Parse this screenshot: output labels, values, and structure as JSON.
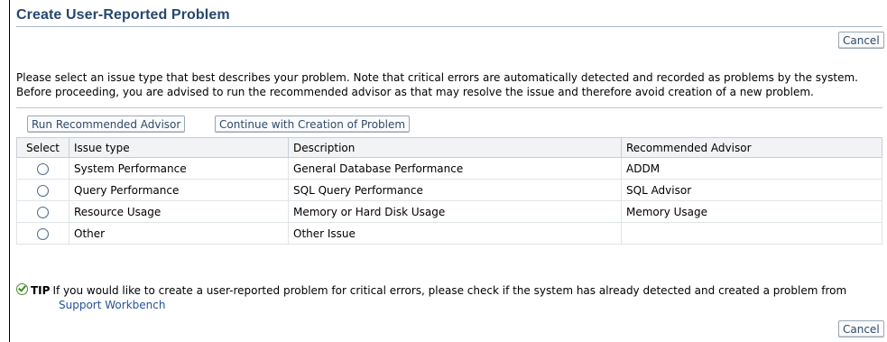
{
  "header": {
    "title": "Create User-Reported Problem",
    "cancel_label": "Cancel"
  },
  "intro": {
    "line1": "Please select an issue type that best describes your problem. Note that critical errors are automatically detected and recorded as problems by the system.",
    "line2": "Before proceeding, you are advised to run the recommended advisor as that may resolve the issue and therefore avoid creation of a new problem."
  },
  "toolbar": {
    "run_label": "Run Recommended Advisor",
    "continue_label": "Continue with Creation of Problem"
  },
  "table": {
    "columns": [
      "Select",
      "Issue type",
      "Description",
      "Recommended Advisor"
    ],
    "rows": [
      {
        "issue": "System Performance",
        "description": "General Database Performance",
        "advisor": "ADDM"
      },
      {
        "issue": "Query Performance",
        "description": "SQL Query Performance",
        "advisor": "SQL Advisor"
      },
      {
        "issue": "Resource Usage",
        "description": "Memory or Hard Disk Usage",
        "advisor": "Memory Usage"
      },
      {
        "issue": "Other",
        "description": "Other Issue",
        "advisor": ""
      }
    ]
  },
  "tip": {
    "icon": "checkmark-circle-icon",
    "label": "TIP",
    "text": "If you would like to create a user-reported problem for critical errors, please check if the system has already detected and created a problem from",
    "link_text": "Support Workbench"
  },
  "footer": {
    "cancel_label": "Cancel"
  },
  "colors": {
    "title": "#27476d",
    "link": "#24529c",
    "tip_icon": "#3d8a1f"
  }
}
